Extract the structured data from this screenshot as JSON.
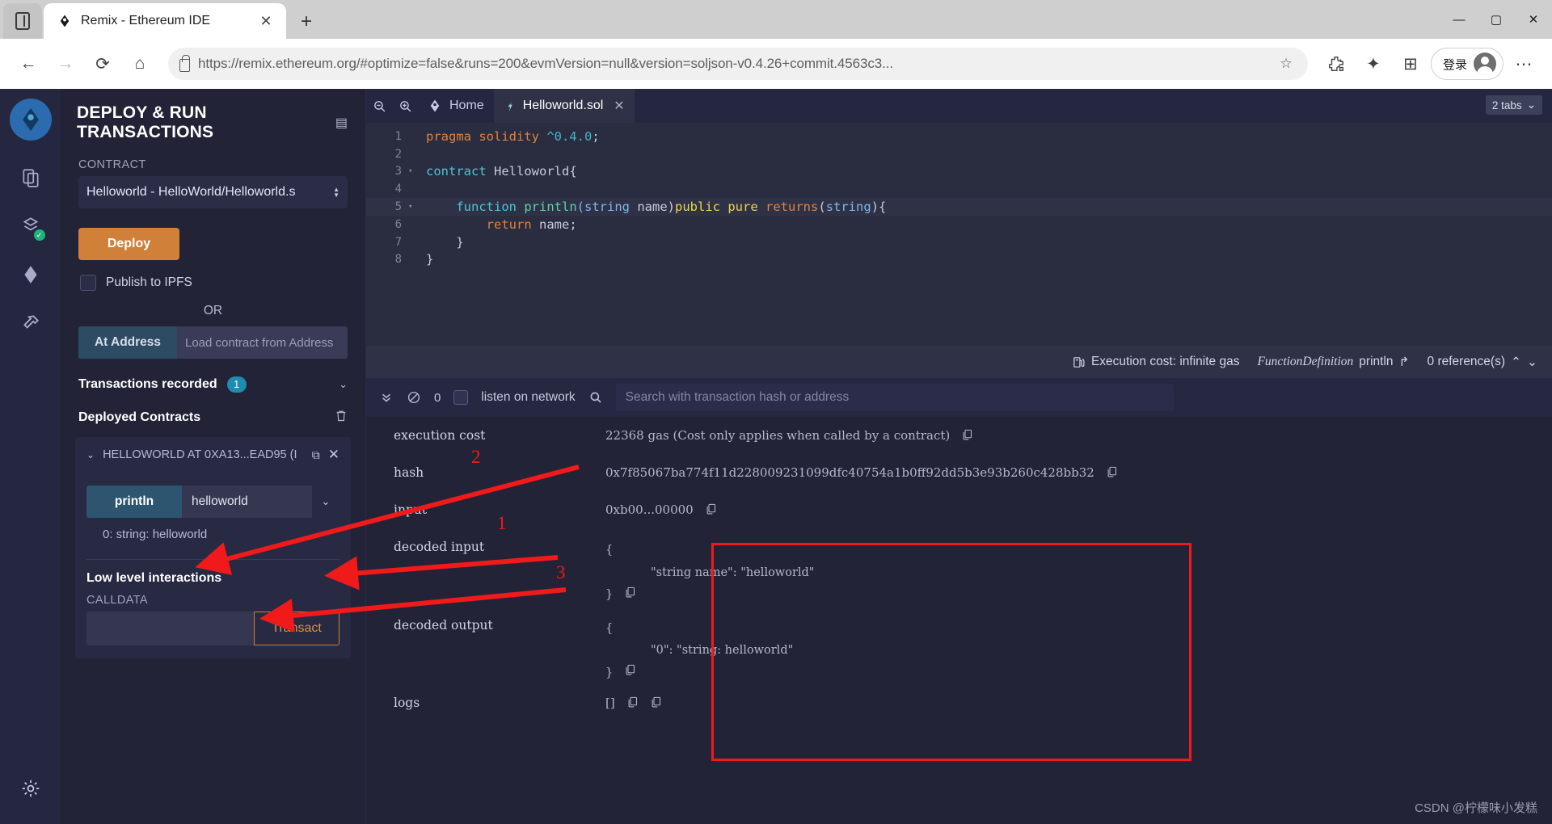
{
  "browser": {
    "tab_title": "Remix - Ethereum IDE",
    "tab_close": "✕",
    "new_tab": "+",
    "url": "https://remix.ethereum.org/#optimize=false&runs=200&evmVersion=null&version=soljson-v0.4.26+commit.4563c3...",
    "login_label": "登录",
    "win_min": "—",
    "win_max": "▢",
    "win_close": "✕",
    "back_icon": "←",
    "forward_icon": "→",
    "reload_icon": "⟳",
    "home_icon": "⌂",
    "star_icon": "☆",
    "puzzle_icon": "⚙",
    "collections_icon": "✦",
    "addtab_icon": "⊞",
    "more_icon": "⋯"
  },
  "sidebar_rail": {
    "items": [
      {
        "name": "file-explorer-icon",
        "glyph": "⧉"
      },
      {
        "name": "solidity-compiler-icon",
        "glyph": "⌬",
        "badge": "✓"
      },
      {
        "name": "deploy-run-icon",
        "glyph": "⬗"
      },
      {
        "name": "plugin-manager-icon",
        "glyph": "⚲"
      }
    ],
    "settings_glyph": "⚙"
  },
  "left_panel": {
    "title": "DEPLOY & RUN TRANSACTIONS",
    "head_icon": "▤",
    "contract_label": "CONTRACT",
    "contract_value": "Helloworld - HelloWorld/Helloworld.s",
    "deploy_label": "Deploy",
    "publish_ipfs_label": "Publish to IPFS",
    "or_label": "OR",
    "at_address_label": "At Address",
    "at_address_placeholder": "Load contract from Address",
    "transactions_recorded_label": "Transactions recorded",
    "transactions_recorded_count": "1",
    "deployed_contracts_label": "Deployed Contracts",
    "contract_card": {
      "title": "HELLOWORLD AT 0XA13...EAD95 (I",
      "chevron": "⌄",
      "copy_icon": "⧉",
      "close_icon": "✕",
      "function_name": "println",
      "function_arg_value": "helloworld",
      "dropdown_caret": "⌄",
      "result_text": "0: string: helloworld"
    },
    "low_level": {
      "title": "Low level interactions",
      "info_icon": "i",
      "calldata_label": "CALLDATA",
      "calldata_value": "",
      "transact_label": "Transact"
    }
  },
  "editor": {
    "zoom_out_icon": "⊖",
    "zoom_in_icon": "⊕",
    "home_tab": "Home",
    "file_tab": "Helloworld.sol",
    "file_tab_close": "✕",
    "tabs_count_label": "2 tabs",
    "tabs_count_caret": "⌄",
    "lines": [
      {
        "n": "1",
        "fold": "",
        "tokens": [
          {
            "t": "pragma solidity ",
            "c": "k-pragma"
          },
          {
            "t": "^0.4.0",
            "c": "k-ver"
          },
          {
            "t": ";",
            "c": "k-name"
          }
        ]
      },
      {
        "n": "2",
        "fold": "",
        "tokens": []
      },
      {
        "n": "3",
        "fold": "▾",
        "tokens": [
          {
            "t": "contract ",
            "c": "k-contract"
          },
          {
            "t": "Helloworld{",
            "c": "k-name"
          }
        ]
      },
      {
        "n": "4",
        "fold": "",
        "tokens": []
      },
      {
        "n": "5",
        "fold": "▾",
        "hl": true,
        "tokens": [
          {
            "t": "    function ",
            "c": "k-func"
          },
          {
            "t": "println",
            "c": "k-fname"
          },
          {
            "t": "(",
            "c": "k-type"
          },
          {
            "t": "string",
            "c": "k-type"
          },
          {
            "t": " name)",
            "c": "k-name"
          },
          {
            "t": "public",
            "c": "k-mod"
          },
          {
            "t": " ",
            "c": "k-name"
          },
          {
            "t": "pure",
            "c": "k-mod"
          },
          {
            "t": " ",
            "c": "k-name"
          },
          {
            "t": "returns",
            "c": "k-ret"
          },
          {
            "t": "(",
            "c": "k-name"
          },
          {
            "t": "string",
            "c": "k-type"
          },
          {
            "t": "){",
            "c": "k-name"
          }
        ]
      },
      {
        "n": "6",
        "fold": "",
        "tokens": [
          {
            "t": "        ",
            "c": "k-name"
          },
          {
            "t": "return",
            "c": "k-ret"
          },
          {
            "t": " name;",
            "c": "k-name"
          }
        ]
      },
      {
        "n": "7",
        "fold": "",
        "tokens": [
          {
            "t": "    }",
            "c": "k-name"
          }
        ]
      },
      {
        "n": "8",
        "fold": "",
        "tokens": [
          {
            "t": "}",
            "c": "k-name"
          }
        ]
      }
    ],
    "status_bar": {
      "gas_icon": "⛽",
      "execution_cost": "Execution cost: infinite gas",
      "definition_kind": "FunctionDefinition",
      "definition_name": "println",
      "jump_icon": "↱",
      "references": "0 reference(s)",
      "up_icon": "⌃",
      "down_icon": "⌄"
    }
  },
  "terminal": {
    "toolbar": {
      "collapse_icon": "⌄⌄",
      "clear_icon": "⊘",
      "count": "0",
      "listen_label": "listen on network",
      "search_icon": "⌕",
      "search_placeholder": "Search with transaction hash or address"
    },
    "rows": [
      {
        "key": "execution cost",
        "value": "22368 gas (Cost only applies when called by a contract)",
        "copy": true
      },
      {
        "key": "hash",
        "value": "0x7f85067ba774f11d228009231099dfc40754a1b0ff92dd5b3e93b260c428bb32",
        "copy": true
      },
      {
        "key": "input",
        "value": "0xb00...00000",
        "copy": true
      }
    ],
    "decoded_input": {
      "key": "decoded input",
      "open": "{",
      "body": "\"string name\": \"helloworld\"",
      "close": "}",
      "copy_icon": "⧉"
    },
    "decoded_output": {
      "key": "decoded output",
      "open": "{",
      "body": "\"0\": \"string: helloworld\"",
      "close": "}",
      "copy_icon": "⧉"
    },
    "logs": {
      "key": "logs",
      "value": "[]",
      "copy_icon_1": "⧉",
      "copy_icon_2": "⧉"
    }
  },
  "annotations": {
    "num1": "1",
    "num2": "2",
    "num3": "3",
    "accent_color": "#f01a1a"
  },
  "watermark": "CSDN @柠檬味小发糕"
}
